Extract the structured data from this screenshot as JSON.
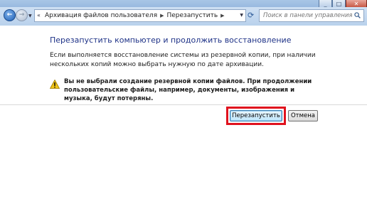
{
  "window": {
    "minimize_glyph": "_",
    "maximize_glyph": "□",
    "close_glyph": "✕"
  },
  "nav": {
    "back_glyph": "←",
    "forward_glyph": "→",
    "breadcrumb": [
      "Архивация файлов пользователя",
      "Перезапустить"
    ],
    "search_placeholder": "Поиск в панели управления"
  },
  "main": {
    "heading": "Перезапустить компьютер и продолжить восстановление",
    "description": "Если выполняется восстановление системы из резервной копии, при наличии нескольких копий можно выбрать нужную по дате архивации.",
    "warning": "Вы не выбрали создание резервной копии файлов. При продолжении пользовательские файлы, например, документы, изображения и музыка, будут потеряны."
  },
  "buttons": {
    "restart_label": "Перезапустить",
    "cancel_label": "Отмена"
  },
  "colors": {
    "heading": "#1e3287",
    "highlight": "#e0121e",
    "warning_icon": "#f0c419"
  }
}
